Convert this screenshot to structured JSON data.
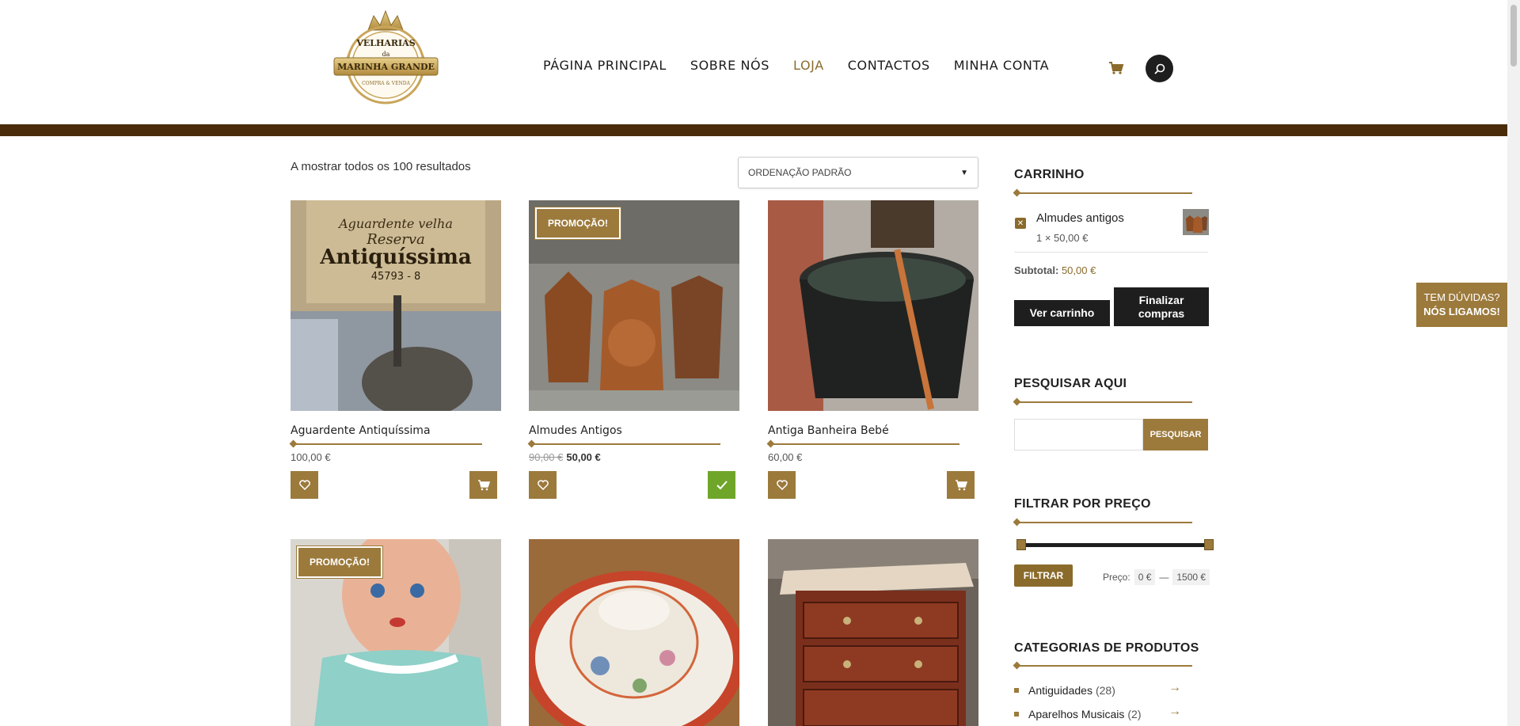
{
  "header": {
    "logo": {
      "line1": "VELHARIAS",
      "line2": "da",
      "line3": "MARINHA GRANDE",
      "line4": "COMPRA & VENDA"
    },
    "nav": [
      {
        "label": "PÁGINA PRINCIPAL",
        "active": false
      },
      {
        "label": "SOBRE NÓS",
        "active": false
      },
      {
        "label": "LOJA",
        "active": true
      },
      {
        "label": "CONTACTOS",
        "active": false
      },
      {
        "label": "MINHA CONTA",
        "active": false
      }
    ],
    "icons": {
      "cart": "cart-icon",
      "search": "search-icon"
    }
  },
  "shop": {
    "results_text": "A mostrar todos os 100 resultados",
    "order_select": "ORDENAÇÃO PADRÃO",
    "products": [
      {
        "name": "Aguardente Antiquíssima",
        "price": "100,00 €",
        "old_price": "",
        "badge": "",
        "in_cart": false
      },
      {
        "name": "Almudes Antigos",
        "price": "50,00 €",
        "old_price": "90,00 €",
        "badge": "PROMOÇÃO!",
        "in_cart": true
      },
      {
        "name": "Antiga Banheira Bebé",
        "price": "60,00 €",
        "old_price": "",
        "badge": "",
        "in_cart": false
      },
      {
        "name": "",
        "price": "",
        "old_price": "",
        "badge": "PROMOÇÃO!",
        "in_cart": false
      },
      {
        "name": "",
        "price": "",
        "old_price": "",
        "badge": "",
        "in_cart": false
      },
      {
        "name": "",
        "price": "",
        "old_price": "",
        "badge": "",
        "in_cart": false
      }
    ]
  },
  "sidebar": {
    "cart": {
      "title": "CARRINHO",
      "item_name": "Almudes antigos",
      "item_qty": "1 × 50,00 €",
      "subtotal_label": "Subtotal:",
      "subtotal_value": "50,00 €",
      "view_cart": "Ver carrinho",
      "checkout": "Finalizar compras"
    },
    "search": {
      "title": "PESQUISAR AQUI",
      "button": "PESQUISAR",
      "placeholder": ""
    },
    "price_filter": {
      "title": "FILTRAR POR PREÇO",
      "button": "FILTRAR",
      "label": "Preço:",
      "min": "0 €",
      "dash": "—",
      "max": "1500 €",
      "min_fraction": 0,
      "max_fraction": 1
    },
    "categories": {
      "title": "CATEGORIAS DE PRODUTOS",
      "items": [
        {
          "label": "Antiguidades",
          "count": "(28)"
        },
        {
          "label": "Aparelhos Musicais",
          "count": "(2)"
        }
      ]
    }
  },
  "floating_tab": {
    "line1": "TEM DÚVIDAS?",
    "line2": "NÓS LIGAMOS!"
  },
  "colors": {
    "accent": "#9c7a3c",
    "band": "#4a2c0b",
    "dark": "#1e1e1e",
    "success": "#6fa62a"
  }
}
